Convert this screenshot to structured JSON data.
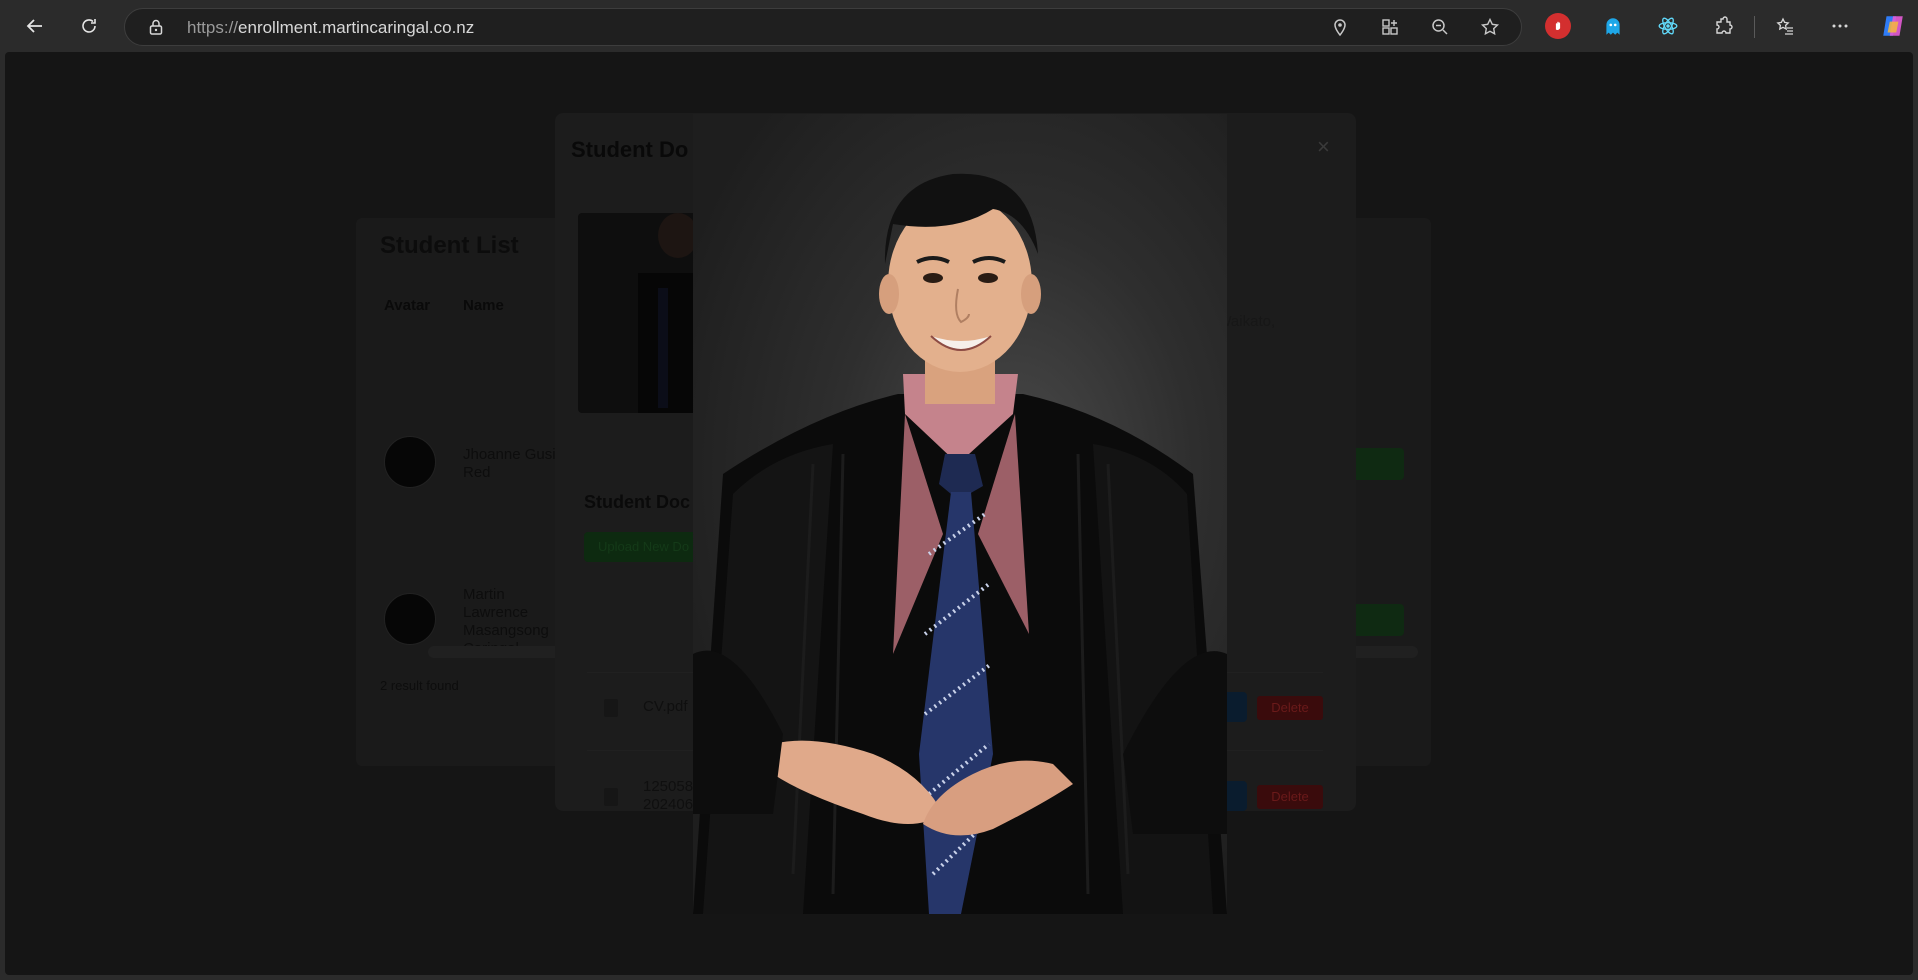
{
  "browser": {
    "url_protocol": "https://",
    "url_host": "enrollment.martincaringal.co.nz",
    "back_label": "Back",
    "refresh_label": "Refresh"
  },
  "page": {
    "list_title": "Student List",
    "columns": [
      "Avatar",
      "Name"
    ],
    "students": [
      {
        "name": "Jhoanne Gusi Red"
      },
      {
        "name": "Martin Lawrence Masangsong Caringal"
      }
    ],
    "found_text": "2 result found"
  },
  "modal": {
    "title": "Student Do",
    "close_label": "×",
    "address_fragment": ", Waikato,",
    "documents_title": "Student Doc",
    "upload_label": "Upload New Do",
    "documents": [
      {
        "name": "CV.pdf",
        "delete_label": "Delete"
      },
      {
        "name": "125058\n202406",
        "delete_label": "Delete"
      }
    ]
  },
  "colors": {
    "accent_green": "#1a7a2a",
    "delete_red": "#c62828",
    "view_blue": "#1565c0"
  }
}
